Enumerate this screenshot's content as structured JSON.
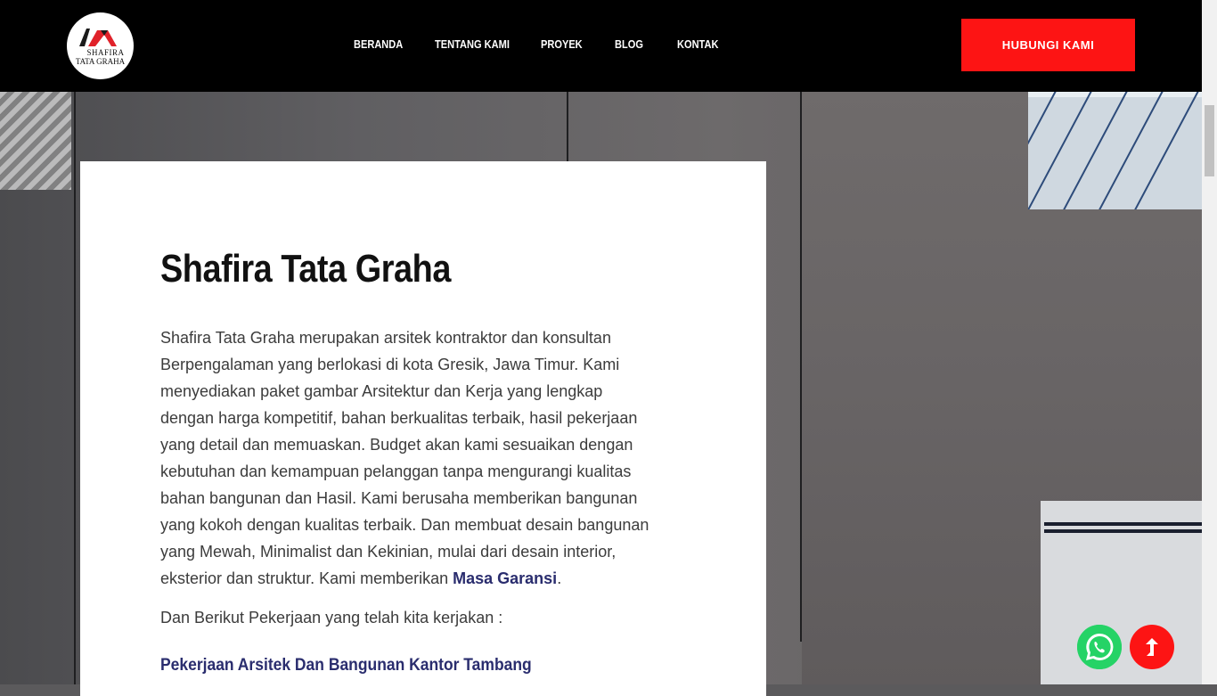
{
  "brand": {
    "logo_line1": "SHAFIRA",
    "logo_line2": "TATA GRAHA",
    "logo_colors": {
      "red": "#e0222a",
      "dark": "#1b1b1b"
    }
  },
  "nav": {
    "items": [
      {
        "label": "BERANDA"
      },
      {
        "label": "TENTANG KAMI"
      },
      {
        "label": "PROYEK"
      },
      {
        "label": "BLOG"
      },
      {
        "label": "KONTAK"
      }
    ],
    "cta_label": "HUBUNGI KAMI"
  },
  "content": {
    "title": "Shafira Tata Graha",
    "body_lines": [
      "Shafira Tata Graha merupakan arsitek kontraktor dan konsultan",
      "Berpengalaman yang berlokasi di kota Gresik, Jawa Timur. Kami",
      "menyediakan paket gambar Arsitektur dan Kerja yang lengkap",
      "dengan harga kompetitif, bahan berkualitas terbaik, hasil pekerjaan",
      "yang detail dan memuaskan. Budget akan kami sesuaikan dengan",
      "kebutuhan dan kemampuan pelanggan tanpa mengurangi kualitas",
      "bahan bangunan dan Hasil. Kami berusaha memberikan bangunan",
      "yang kokoh dengan kualitas terbaik. Dan membuat desain bangunan",
      "yang Mewah, Minimalist dan Kekinian, mulai dari desain interior,"
    ],
    "last_line_prefix": "eksterior dan struktur. Kami memberikan ",
    "last_line_link": "Masa Garansi",
    "last_line_suffix": ".",
    "intro": "Dan Berikut Pekerjaan yang telah kita kerjakan :",
    "project_heading": "Pekerjaan Arsitek Dan Bangunan Kantor Tambang"
  },
  "floating": {
    "whatsapp_icon": "whatsapp-icon",
    "scroll_top_icon": "arrow-up-icon"
  },
  "colors": {
    "header_bg": "#000000",
    "accent_red": "#fd1414",
    "link_navy": "#2a2d6e",
    "whatsapp_green": "#25d366"
  }
}
